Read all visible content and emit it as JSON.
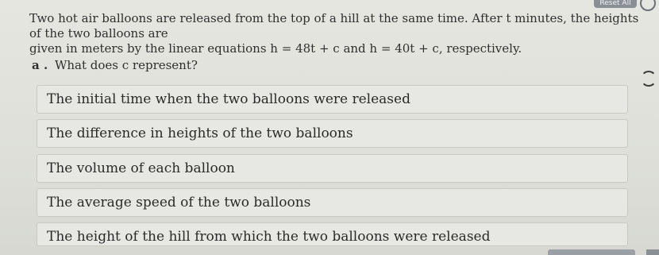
{
  "toolbar": {
    "reset_label": "Reset All"
  },
  "question": {
    "line1": "Two hot air balloons are released from the top of a hill at the same time. After t minutes, the heights of the two balloons are",
    "line2": "given in meters by the linear equations h = 48t + c and h = 40t + c, respectively."
  },
  "part": {
    "marker": "a .",
    "prompt": "What does c represent?"
  },
  "options": [
    "The initial time when the two balloons were released",
    "The difference in heights of the two balloons",
    "The volume of each balloon",
    "The average speed of the two balloons",
    "The height of the hill from which the two balloons were released"
  ]
}
